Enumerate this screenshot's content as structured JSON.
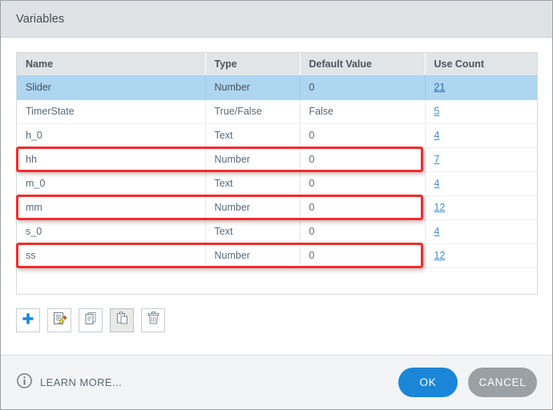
{
  "dialog": {
    "title": "Variables"
  },
  "table": {
    "columns": [
      "Name",
      "Type",
      "Default Value",
      "Use Count"
    ],
    "rows": [
      {
        "name": "Slider",
        "type": "Number",
        "default": "0",
        "use": "21",
        "selected": true,
        "highlighted": false
      },
      {
        "name": "TimerState",
        "type": "True/False",
        "default": "False",
        "use": "5",
        "selected": false,
        "highlighted": false
      },
      {
        "name": "h_0",
        "type": "Text",
        "default": "0",
        "use": "4",
        "selected": false,
        "highlighted": false
      },
      {
        "name": "hh",
        "type": "Number",
        "default": "0",
        "use": "7",
        "selected": false,
        "highlighted": true
      },
      {
        "name": "m_0",
        "type": "Text",
        "default": "0",
        "use": "4",
        "selected": false,
        "highlighted": false
      },
      {
        "name": "mm",
        "type": "Number",
        "default": "0",
        "use": "12",
        "selected": false,
        "highlighted": true
      },
      {
        "name": "s_0",
        "type": "Text",
        "default": "0",
        "use": "4",
        "selected": false,
        "highlighted": false
      },
      {
        "name": "ss",
        "type": "Number",
        "default": "0",
        "use": "12",
        "selected": false,
        "highlighted": true
      }
    ]
  },
  "toolbar": {
    "buttons": [
      {
        "icon": "add-plus-icon",
        "pressed": false
      },
      {
        "icon": "edit-pencil-icon",
        "pressed": false
      },
      {
        "icon": "copy-icon",
        "pressed": false
      },
      {
        "icon": "paste-icon",
        "pressed": true
      },
      {
        "icon": "delete-trash-icon",
        "pressed": false
      }
    ]
  },
  "footer": {
    "learn_more_label": "LEARN MORE...",
    "info_icon": "info-circle-icon",
    "ok_label": "OK",
    "cancel_label": "CANCEL"
  },
  "colors": {
    "titlebar_bg": "#dfe3e6",
    "header_bg": "#e1e5e8",
    "selected_row": "#aed6f1",
    "highlight_border": "#f22c2c",
    "link": "#3f8fd0",
    "ok_button": "#1b86d8",
    "cancel_button": "#9aa1a6",
    "footer_bg": "#f3f4f5"
  }
}
